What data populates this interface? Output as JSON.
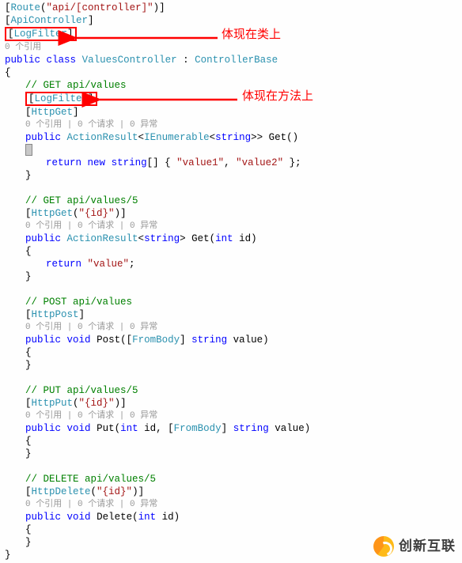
{
  "annotations": {
    "class_level": "体现在类上",
    "method_level": "体现在方法上"
  },
  "watermark_text": "创新互联",
  "code": {
    "route_attr": "[Route(\"api/[controller]\")]",
    "api_attr": "[ApiController]",
    "logfilter_attr": "[LogFilter]",
    "lens_root": "0 个引用",
    "class_decl_1": "public",
    "class_decl_2": "class",
    "class_name": "ValuesController",
    "class_base": "ControllerBase",
    "brace_open": "{",
    "brace_close": "}",
    "get_all": {
      "comment": "// GET api/values",
      "httpget": "[HttpGet]",
      "lens": "0 个引用 | 0 个请求 | 0 异常",
      "sig_pub": "public",
      "sig_ret": "ActionResult",
      "sig_gen1": "IEnumerable",
      "sig_gen2": "string",
      "sig_name": "Get",
      "ret_kw": "return",
      "ret_new": "new",
      "ret_type": "string",
      "v1": "\"value1\"",
      "v2": "\"value2\""
    },
    "get_one": {
      "comment": "// GET api/values/5",
      "httpget": "[HttpGet(\"{id}\")]",
      "lens": "0 个引用 | 0 个请求 | 0 异常",
      "sig_pub": "public",
      "sig_ret": "ActionResult",
      "sig_gen": "string",
      "sig_name": "Get",
      "p_type": "int",
      "p_name": "id",
      "ret_kw": "return",
      "ret_val": "\"value\""
    },
    "post": {
      "comment": "// POST api/values",
      "attr": "[HttpPost]",
      "lens": "0 个引用 | 0 个请求 | 0 异常",
      "sig_pub": "public",
      "sig_void": "void",
      "sig_name": "Post",
      "frombody": "FromBody",
      "p_type": "string",
      "p_name": "value"
    },
    "put": {
      "comment": "// PUT api/values/5",
      "attr": "[HttpPut(\"{id}\")]",
      "lens": "0 个引用 | 0 个请求 | 0 异常",
      "sig_pub": "public",
      "sig_void": "void",
      "sig_name": "Put",
      "p1_type": "int",
      "p1_name": "id",
      "frombody": "FromBody",
      "p2_type": "string",
      "p2_name": "value"
    },
    "del": {
      "comment": "// DELETE api/values/5",
      "attr": "[HttpDelete(\"{id}\")]",
      "lens": "0 个引用 | 0 个请求 | 0 异常",
      "sig_pub": "public",
      "sig_void": "void",
      "sig_name": "Delete",
      "p_type": "int",
      "p_name": "id"
    }
  }
}
